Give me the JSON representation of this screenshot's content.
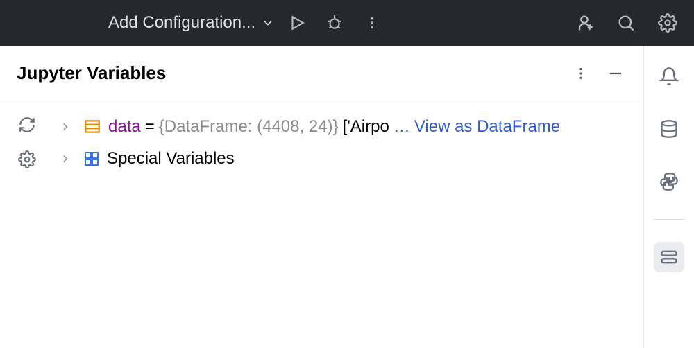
{
  "toolbar": {
    "config_label": "Add Configuration..."
  },
  "panel": {
    "title": "Jupyter Variables"
  },
  "tree": {
    "rows": [
      {
        "name": "data",
        "equals": "=",
        "type": "{DataFrame: (4408, 24)}",
        "preview": "['Airpo",
        "ellipsis": "…",
        "action": "View as DataFrame"
      },
      {
        "label": "Special Variables"
      }
    ]
  }
}
